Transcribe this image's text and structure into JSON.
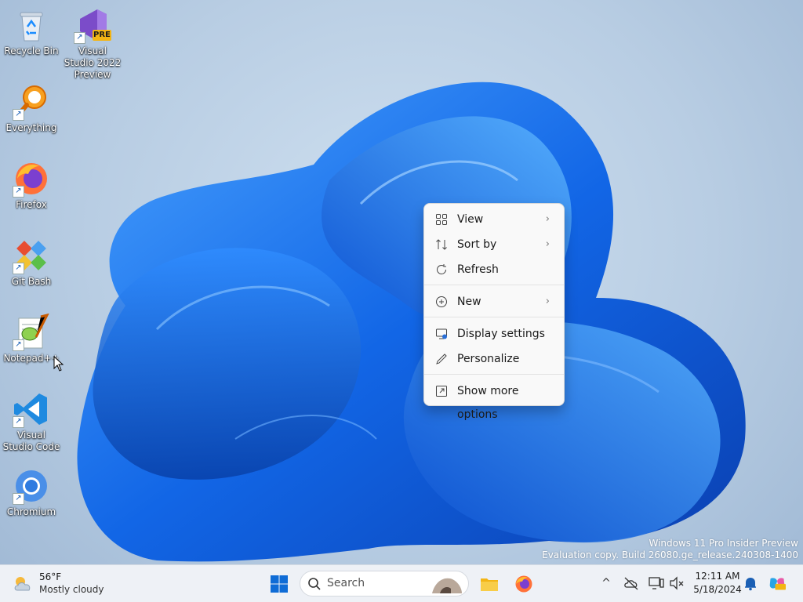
{
  "desktop": {
    "icons": [
      {
        "label": "Recycle Bin",
        "icon": "recycle-bin-icon"
      },
      {
        "label": "Visual Studio 2022 Preview",
        "icon": "visual-studio-preview-icon",
        "badge": "PRE"
      },
      {
        "label": "Everything",
        "icon": "everything-search-icon"
      },
      {
        "label": "Firefox",
        "icon": "firefox-icon"
      },
      {
        "label": "Git Bash",
        "icon": "git-bash-icon"
      },
      {
        "label": "Notepad++",
        "icon": "notepad-plus-plus-icon"
      },
      {
        "label": "Visual Studio Code",
        "icon": "vscode-icon"
      },
      {
        "label": "Chromium",
        "icon": "chromium-icon"
      }
    ]
  },
  "context_menu": {
    "items": [
      {
        "label": "View",
        "icon": "view-grid-icon",
        "submenu": true
      },
      {
        "label": "Sort by",
        "icon": "sort-icon",
        "submenu": true
      },
      {
        "label": "Refresh",
        "icon": "refresh-icon",
        "submenu": false
      },
      {
        "label": "New",
        "icon": "new-plus-icon",
        "submenu": true
      },
      {
        "label": "Display settings",
        "icon": "display-settings-icon",
        "submenu": false
      },
      {
        "label": "Personalize",
        "icon": "pen-icon",
        "submenu": false
      },
      {
        "label": "Show more options",
        "icon": "show-more-icon",
        "submenu": false
      }
    ],
    "chevron": "›"
  },
  "watermark": {
    "line1": "Windows 11 Pro Insider Preview",
    "line2": "Evaluation copy. Build 26080.ge_release.240308-1400"
  },
  "taskbar": {
    "weather": {
      "temp": "56°F",
      "desc": "Mostly cloudy"
    },
    "search": {
      "placeholder": "Search"
    },
    "pinned": [
      "start-icon",
      "file-explorer-icon",
      "firefox-icon"
    ],
    "tray_chevron": "^",
    "clock": {
      "time": "12:11 AM",
      "date": "5/18/2024"
    }
  },
  "colors": {
    "accent": "#0067c0",
    "wallpaper_blue": "#1a6fe0",
    "menu_bg": "#f9f9f9",
    "taskbar_bg": "#eef1f6"
  }
}
